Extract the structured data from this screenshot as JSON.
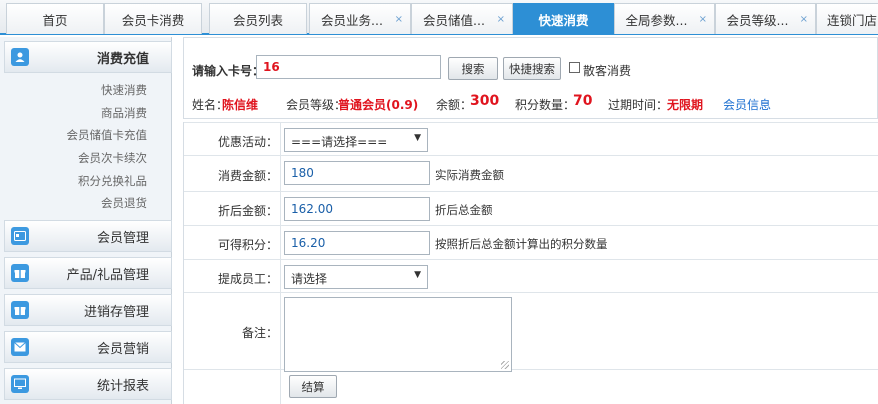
{
  "tabs": [
    {
      "label": "首页",
      "closable": false,
      "active": false
    },
    {
      "label": "会员卡消费",
      "closable": false,
      "active": false
    },
    {
      "label": "会员列表",
      "closable": false,
      "active": false
    },
    {
      "label": "会员业务...",
      "closable": true,
      "active": false
    },
    {
      "label": "会员储值...",
      "closable": true,
      "active": false
    },
    {
      "label": "快速消费",
      "closable": false,
      "active": true
    },
    {
      "label": "全局参数...",
      "closable": true,
      "active": false
    },
    {
      "label": "会员等级...",
      "closable": true,
      "active": false
    },
    {
      "label": "连锁门店",
      "closable": false,
      "active": false
    }
  ],
  "close_glyph": "×",
  "sidebar": {
    "sections": [
      {
        "label": "消费充值",
        "icon": "user-icon",
        "active": true,
        "items": [
          "快速消费",
          "商品消费",
          "会员储值卡充值",
          "会员次卡续次",
          "积分兑换礼品",
          "会员退货"
        ]
      },
      {
        "label": "会员管理",
        "icon": "card-icon"
      },
      {
        "label": "产品/礼品管理",
        "icon": "gift-icon"
      },
      {
        "label": "进销存管理",
        "icon": "gift-icon"
      },
      {
        "label": "会员营销",
        "icon": "mail-icon"
      },
      {
        "label": "统计报表",
        "icon": "monitor-icon"
      }
    ]
  },
  "search": {
    "card_label": "请输入卡号：",
    "card_value": "16",
    "search_button": "搜索",
    "quick_search_button": "快捷搜索",
    "walkin_label": "散客消费",
    "walkin_checked": false
  },
  "member": {
    "name_label": "姓名：",
    "name": "陈信维",
    "level_label": "会员等级：",
    "level": "普通会员(0.9)",
    "balance_label": "余额：",
    "balance": "300",
    "points_label": "积分数量：",
    "points": "70",
    "expiry_label": "过期时间：",
    "expiry": "无限期",
    "info_link": "会员信息"
  },
  "form": {
    "promo_label": "优惠活动：",
    "promo_value": "===请选择===",
    "amount_label": "消费金额：",
    "amount_value": "180",
    "amount_hint": "实际消费金额",
    "discounted_label": "折后金额：",
    "discounted_value": "162.00",
    "discounted_hint": "折后总金额",
    "points_label": "可得积分：",
    "points_value": "16.20",
    "points_hint": "按照折后总金额计算出的积分数量",
    "staff_label": "提成员工：",
    "staff_value": "请选择",
    "remark_label": "备注：",
    "remark_value": "",
    "submit_button": "结算"
  },
  "colors": {
    "accent": "#2d8fd5",
    "highlight": "#e0141e",
    "link": "#1a6ed0"
  }
}
